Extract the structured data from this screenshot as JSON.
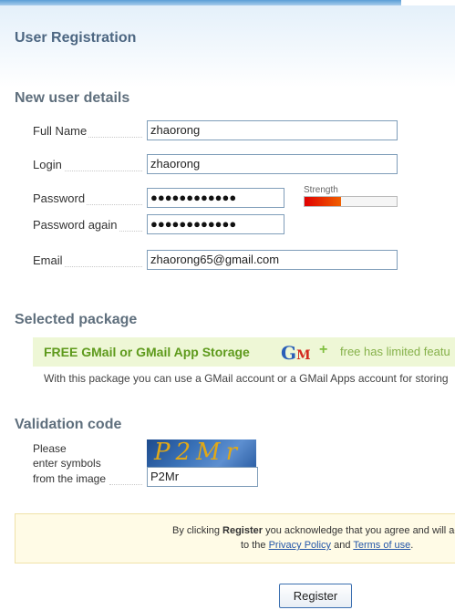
{
  "page": {
    "title": "User Registration"
  },
  "user_details": {
    "heading": "New user details",
    "full_name": {
      "label": "Full Name",
      "value": "zhaorong"
    },
    "login": {
      "label": "Login",
      "value": "zhaorong"
    },
    "password": {
      "label": "Password",
      "value": "●●●●●●●●●●●●"
    },
    "password_again": {
      "label": "Password again",
      "value": "●●●●●●●●●●●●"
    },
    "strength": {
      "label": "Strength",
      "level": 0.4,
      "color": "#e02000"
    },
    "email": {
      "label": "Email",
      "value": "zhaorong65@gmail.com"
    }
  },
  "package": {
    "heading": "Selected package",
    "name": "FREE GMail or GMail App Storage",
    "logo_g": "G",
    "logo_m": "M",
    "plus": "+",
    "note": "free has limited featu",
    "description": "With this package you can use a GMail account or a GMail Apps account for storing"
  },
  "validation": {
    "heading": "Validation code",
    "instruction_line1": "Please",
    "instruction_line2": "enter symbols",
    "instruction_line3": "from the image",
    "captcha_text": "P2Mr",
    "input_value": "P2Mr"
  },
  "notice": {
    "line1_before": "By clicking ",
    "line1_bold": "Register",
    "line1_after": " you acknowledge that you agree and will ac",
    "line2_before": "to the ",
    "privacy_link": "Privacy Policy",
    "line2_and": " and ",
    "terms_link": "Terms of use",
    "line2_end": "."
  },
  "actions": {
    "register_label": "Register"
  }
}
